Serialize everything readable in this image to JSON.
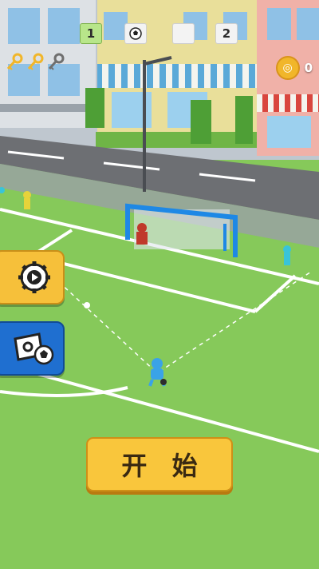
{
  "hud": {
    "left_score": "1",
    "right_score": "2",
    "ball_icon": "soccer-ball-icon",
    "goal_icon": "white-square-icon"
  },
  "keys": {
    "collected": 2,
    "total": 3
  },
  "coins": {
    "value": "0"
  },
  "buttons": {
    "settings_icon": "gear-play-icon",
    "skins_icon": "ticket-ball-icon",
    "start_label": "开 始"
  },
  "colors": {
    "grass": "#86c95a",
    "road": "#6d6f73",
    "start_button": "#f9c63c",
    "settings_button": "#f6c03a",
    "skins_button": "#1f6fd0",
    "goal_frame": "#1e88e5",
    "player": "#3aa3e8"
  }
}
